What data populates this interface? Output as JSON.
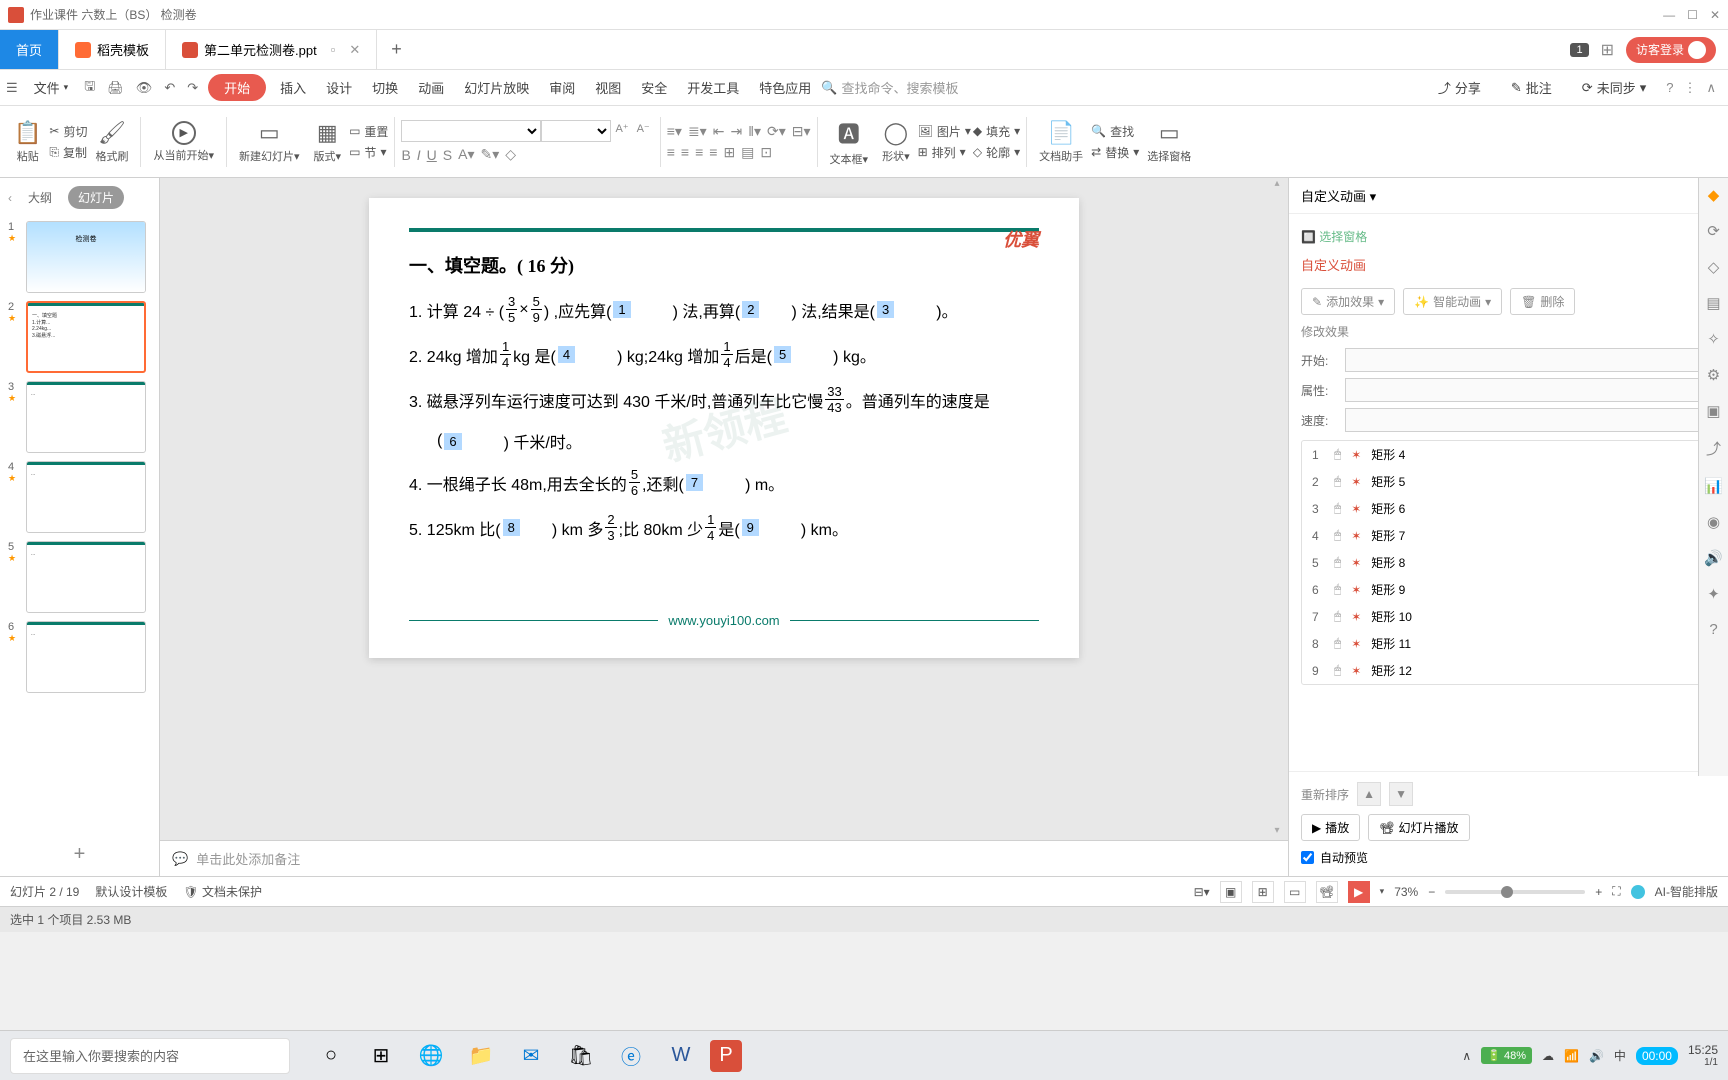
{
  "titlebar": {
    "doc_title": "作业课件  六数上（BS）    检测卷"
  },
  "tabs": {
    "home": "首页",
    "template": "稻壳模板",
    "current": "第二单元检测卷.ppt",
    "badge": "1",
    "login": "访客登录"
  },
  "menu": {
    "file": "文件",
    "items": [
      "开始",
      "插入",
      "设计",
      "切换",
      "动画",
      "幻灯片放映",
      "审阅",
      "视图",
      "安全",
      "开发工具",
      "特色应用"
    ],
    "search_placeholder": "查找命令、搜索模板",
    "share": "分享",
    "annotate": "批注",
    "unsync": "未同步"
  },
  "ribbon": {
    "paste": "粘贴",
    "cut": "剪切",
    "copy": "复制",
    "format_painter": "格式刷",
    "play_from": "从当前开始",
    "new_slide": "新建幻灯片",
    "layout": "版式",
    "reset": "重置",
    "section": "节",
    "textbox": "文本框",
    "shape": "形状",
    "picture": "图片",
    "arrange": "排列",
    "fill": "填充",
    "outline": "轮廓",
    "doc_assist": "文档助手",
    "find": "查找",
    "replace": "替换",
    "select_pane": "选择窗格"
  },
  "slidepanel": {
    "outline": "大纲",
    "slides": "幻灯片"
  },
  "slide": {
    "logo": "优翼",
    "title": "一、填空题。( 16 分)",
    "q1_pre": "1. 计算 24 ÷ (",
    "q1_mid": " ) ,应先算(",
    "q1_b1": "1",
    "q1_m2": ") 法,再算(",
    "q1_b2": "2",
    "q1_m3": ") 法,结果是(",
    "q1_b3": "3",
    "q1_end": ")。",
    "q2_pre": "2.  24kg 增加",
    "q2_m1": "kg 是(",
    "q2_b4": "4",
    "q2_m2": ") kg;24kg 增加",
    "q2_m3": "后是(",
    "q2_b5": "5",
    "q2_end": ") kg。",
    "q3_pre": "3. 磁悬浮列车运行速度可达到 430 千米/时,普通列车比它慢",
    "q3_m1": "。普通列车的速度是",
    "q3_b6": "6",
    "q3_m2": "(",
    "q3_end": ") 千米/时。",
    "q4_pre": "4. 一根绳子长 48m,用去全长的",
    "q4_m1": ",还剩(",
    "q4_b7": "7",
    "q4_end": ") m。",
    "q5_pre": "5.  125km 比(",
    "q5_b8": "8",
    "q5_m1": ") km 多",
    "q5_m2": ";比 80km 少",
    "q5_m3": "是(",
    "q5_b9": "9",
    "q5_end": ") km。",
    "url": "www.youyi100.com",
    "watermark": "新领程"
  },
  "notes": {
    "placeholder": "单击此处添加备注"
  },
  "anim": {
    "title": "自定义动画",
    "select_pane": "选择窗格",
    "custom": "自定义动画",
    "add_effect": "添加效果",
    "smart_anim": "智能动画",
    "delete": "删除",
    "modify": "修改效果",
    "start": "开始:",
    "property": "属性:",
    "speed": "速度:",
    "reorder": "重新排序",
    "play": "播放",
    "slideshow": "幻灯片播放",
    "autopreview": "自动预览",
    "items": [
      {
        "num": "1",
        "name": "矩形 4"
      },
      {
        "num": "2",
        "name": "矩形 5"
      },
      {
        "num": "3",
        "name": "矩形 6"
      },
      {
        "num": "4",
        "name": "矩形 7"
      },
      {
        "num": "5",
        "name": "矩形 8"
      },
      {
        "num": "6",
        "name": "矩形 9"
      },
      {
        "num": "7",
        "name": "矩形 10"
      },
      {
        "num": "8",
        "name": "矩形 11"
      },
      {
        "num": "9",
        "name": "矩形 12"
      }
    ]
  },
  "status": {
    "slide_pos": "幻灯片 2 / 19",
    "template": "默认设计模板",
    "protect": "文档未保护",
    "zoom": "73%",
    "ai": "AI-智能排版"
  },
  "selection": {
    "text": "选中 1 个项目  2.53 MB"
  },
  "taskbar": {
    "search_placeholder": "在这里输入你要搜索的内容",
    "battery": "48%",
    "ime": "中",
    "time": "15:25",
    "rec_time": "00:00",
    "date_frag": "1/1"
  }
}
